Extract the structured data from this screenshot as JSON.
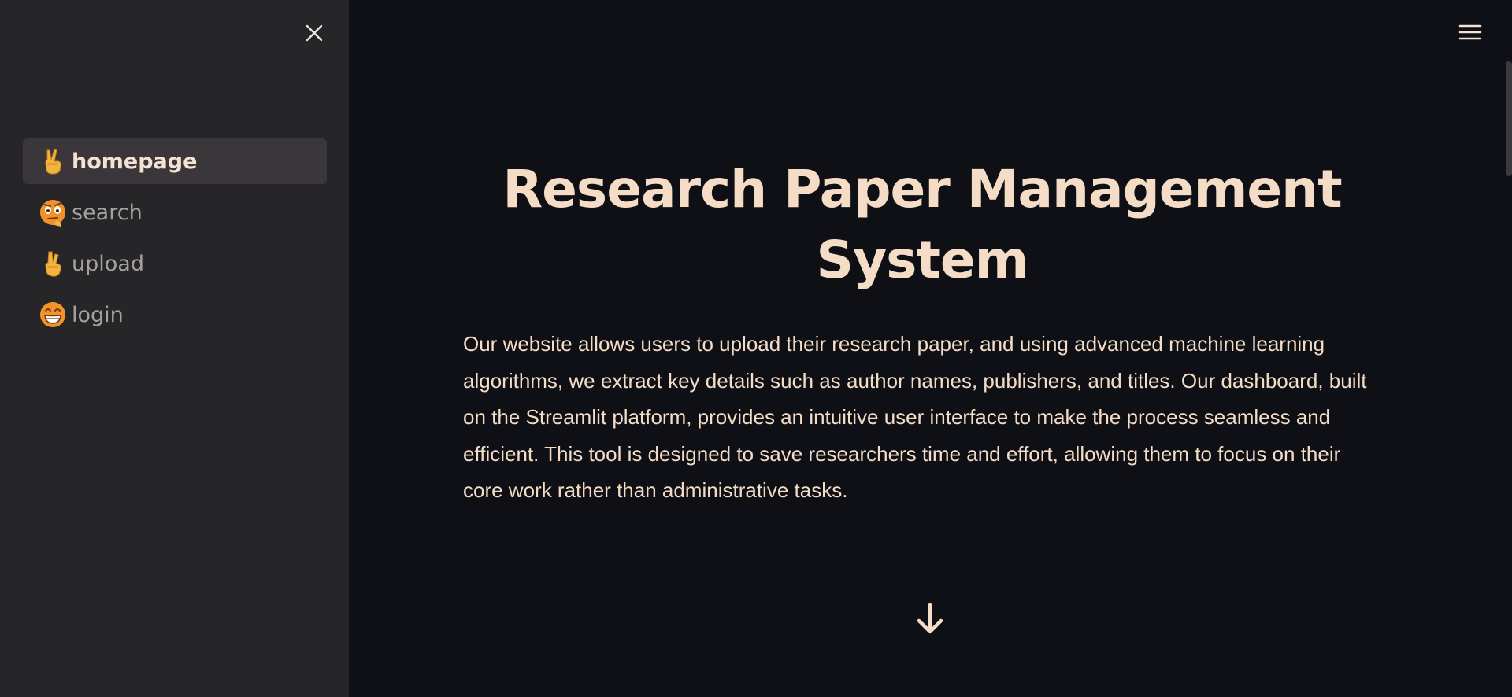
{
  "sidebar": {
    "close_icon": "close-icon",
    "items": [
      {
        "label": "homepage",
        "emoji": "✌️",
        "active": true
      },
      {
        "label": "search",
        "emoji": "🤨",
        "active": false
      },
      {
        "label": "upload",
        "emoji": "🤞",
        "active": false
      },
      {
        "label": "login",
        "emoji": "😁",
        "active": false
      }
    ]
  },
  "main": {
    "menu_icon": "hamburger-menu-icon",
    "title": "Research Paper Management System",
    "description": "Our website allows users to upload their research paper, and using advanced machine learning algorithms, we extract key details such as author names, publishers, and titles. Our dashboard, built on the Streamlit platform, provides an intuitive user interface to make the process seamless and efficient. This tool is designed to save researchers time and effort, allowing them to focus on their core work rather than administrative tasks.",
    "scroll_icon": "arrow-down-icon"
  },
  "colors": {
    "sidebar_bg": "#262629",
    "main_bg": "#0e1015",
    "text": "#f5dcc6",
    "muted_text": "#a7a19c",
    "active_item_bg": "#3a3639"
  }
}
